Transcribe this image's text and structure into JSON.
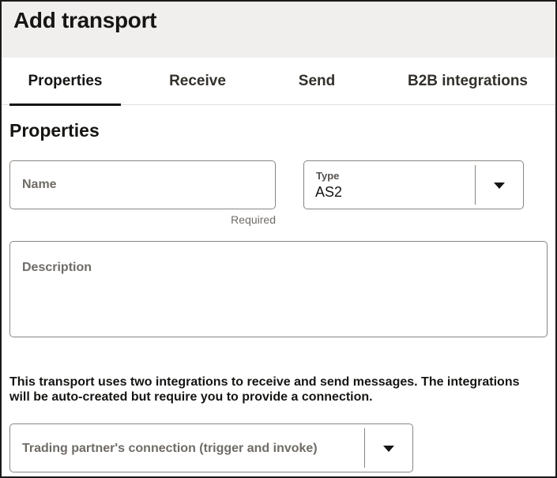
{
  "dialog": {
    "title": "Add transport"
  },
  "tabs": [
    {
      "label": "Properties",
      "selected": true
    },
    {
      "label": "Receive",
      "selected": false
    },
    {
      "label": "Send",
      "selected": false
    },
    {
      "label": "B2B integrations",
      "selected": false
    }
  ],
  "properties": {
    "section_title": "Properties",
    "name": {
      "placeholder": "Name",
      "value": "",
      "helper": "Required"
    },
    "type": {
      "label": "Type",
      "value": "AS2",
      "icon": "caret-down-icon"
    },
    "description": {
      "placeholder": "Description",
      "value": ""
    },
    "info_text": "This transport uses two integrations to receive and send messages. The integrations will be auto-created but require you to provide a connection.",
    "connection": {
      "placeholder": "Trading partner's connection (trigger and invoke)",
      "value": "",
      "icon": "caret-down-icon"
    }
  }
}
